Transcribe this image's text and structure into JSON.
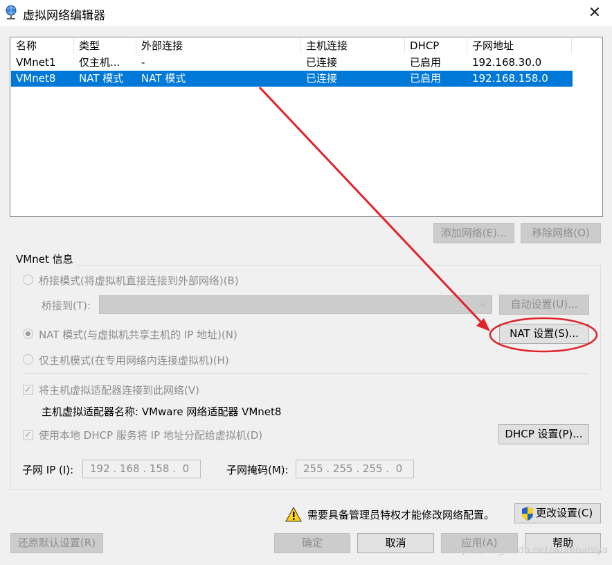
{
  "window": {
    "title": "虚拟网络编辑器",
    "icon": "network-globe-icon",
    "close_icon": "close-icon"
  },
  "table": {
    "headers": [
      "名称",
      "类型",
      "外部连接",
      "主机连接",
      "DHCP",
      "子网地址"
    ],
    "rows": [
      {
        "cells": [
          "VMnet1",
          "仅主机...",
          "-",
          "已连接",
          "已启用",
          "192.168.30.0"
        ],
        "selected": false
      },
      {
        "cells": [
          "VMnet8",
          "NAT 模式",
          "NAT 模式",
          "已连接",
          "已启用",
          "192.168.158.0"
        ],
        "selected": true
      }
    ]
  },
  "list_buttons": {
    "add": "添加网络(E)...",
    "remove": "移除网络(O)"
  },
  "vmnet_info": {
    "group_label": "VMnet 信息",
    "bridge_label": "桥接模式(将虚拟机直接连接到外部网络)(B)",
    "bridge_to_label": "桥接到(T):",
    "bridge_to_value": "",
    "auto_settings": "自动设置(U)...",
    "nat_label": "NAT 模式(与虚拟机共享主机的 IP 地址)(N)",
    "nat_settings": "NAT 设置(S)...",
    "hostonly_label": "仅主机模式(在专用网络内连接虚拟机)(H)",
    "selected_mode": "nat",
    "connect_adapter_label": "将主机虚拟适配器连接到此网络(V)",
    "connect_adapter_checked": true,
    "adapter_name_label": "主机虚拟适配器名称: VMware 网络适配器 VMnet8",
    "dhcp_label": "使用本地 DHCP 服务将 IP 地址分配给虚拟机(D)",
    "dhcp_checked": true,
    "dhcp_settings": "DHCP 设置(P)...",
    "subnet_ip_label": "子网 IP (I):",
    "subnet_ip": "192 . 168 . 158 .  0",
    "subnet_mask_label": "子网掩码(M):",
    "subnet_mask": "255 . 255 . 255 .  0"
  },
  "admin": {
    "warning_text": "需要具备管理员特权才能修改网络配置。",
    "change_settings": "更改设置(C)",
    "warning_icon": "warning-icon",
    "shield_icon": "uac-shield-icon"
  },
  "footer": {
    "restore": "还原默认设置(R)",
    "ok": "确定",
    "cancel": "取消",
    "apply": "应用(A)",
    "help": "帮助"
  },
  "watermark": "https://blog.csdn.net/wudinaniya",
  "annotation": {
    "color": "#e0222a"
  }
}
